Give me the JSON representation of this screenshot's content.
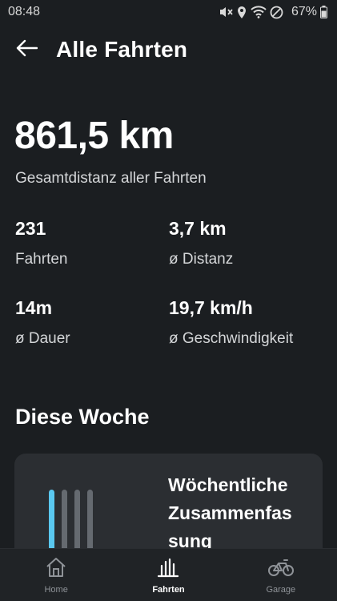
{
  "status_bar": {
    "time": "08:48",
    "battery": "67%",
    "icons": [
      "mute-icon",
      "location-icon",
      "wifi-icon",
      "do-not-disturb-icon",
      "battery-icon"
    ]
  },
  "header": {
    "back_icon": "arrow-left-icon",
    "title": "Alle Fahrten"
  },
  "summary": {
    "total_distance": "861,5 km",
    "total_caption": "Gesamtdistanz aller Fahrten",
    "stats": [
      {
        "value": "231",
        "label": "Fahrten"
      },
      {
        "value": "3,7 km",
        "label": "ø Distanz"
      },
      {
        "value": "14m",
        "label": "ø Dauer"
      },
      {
        "value": "19,7 km/h",
        "label": "ø Geschwindigkeit"
      }
    ]
  },
  "week": {
    "section_title": "Diese Woche",
    "card_title": "Wöchentliche Zusammenfas sung",
    "bar_colors": [
      "#5ac8f0",
      "#656a70",
      "#656a70",
      "#656a70"
    ]
  },
  "nav": {
    "items": [
      {
        "label": "Home",
        "icon": "home-icon",
        "active": false
      },
      {
        "label": "Fahrten",
        "icon": "bar-chart-icon",
        "active": true
      },
      {
        "label": "Garage",
        "icon": "bicycle-icon",
        "active": false
      }
    ]
  },
  "colors": {
    "background": "#1b1e21",
    "card": "#2b2e32",
    "accent": "#5ac8f0",
    "nav_background": "#202326"
  }
}
